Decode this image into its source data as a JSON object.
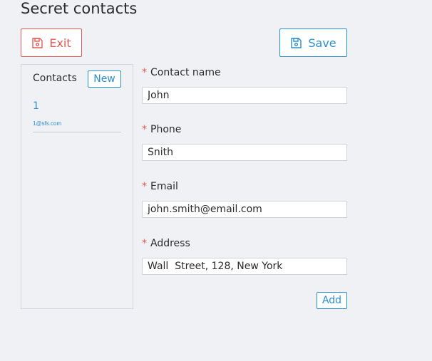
{
  "page": {
    "title": "Secret contacts"
  },
  "toolbar": {
    "exit_label": "Exit",
    "exit_icon": "floppy-disk-icon",
    "save_label": "Save",
    "save_icon": "floppy-disk-icon"
  },
  "sidebar": {
    "title": "Contacts",
    "new_label": "New",
    "items": [
      {
        "name": "1",
        "email": "1@sfs.com"
      }
    ]
  },
  "form": {
    "required_marker": "*",
    "fields": [
      {
        "label": "Contact name",
        "value": "John"
      },
      {
        "label": "Phone",
        "value": "Snith"
      },
      {
        "label": "Email",
        "value": "john.smith@email.com"
      },
      {
        "label": "Address",
        "value": "Wall  Street, 128, New York"
      }
    ],
    "add_label": "Add"
  },
  "colors": {
    "danger": "#e45a54",
    "primary": "#2b8fd0",
    "background": "#f0f1f5"
  }
}
